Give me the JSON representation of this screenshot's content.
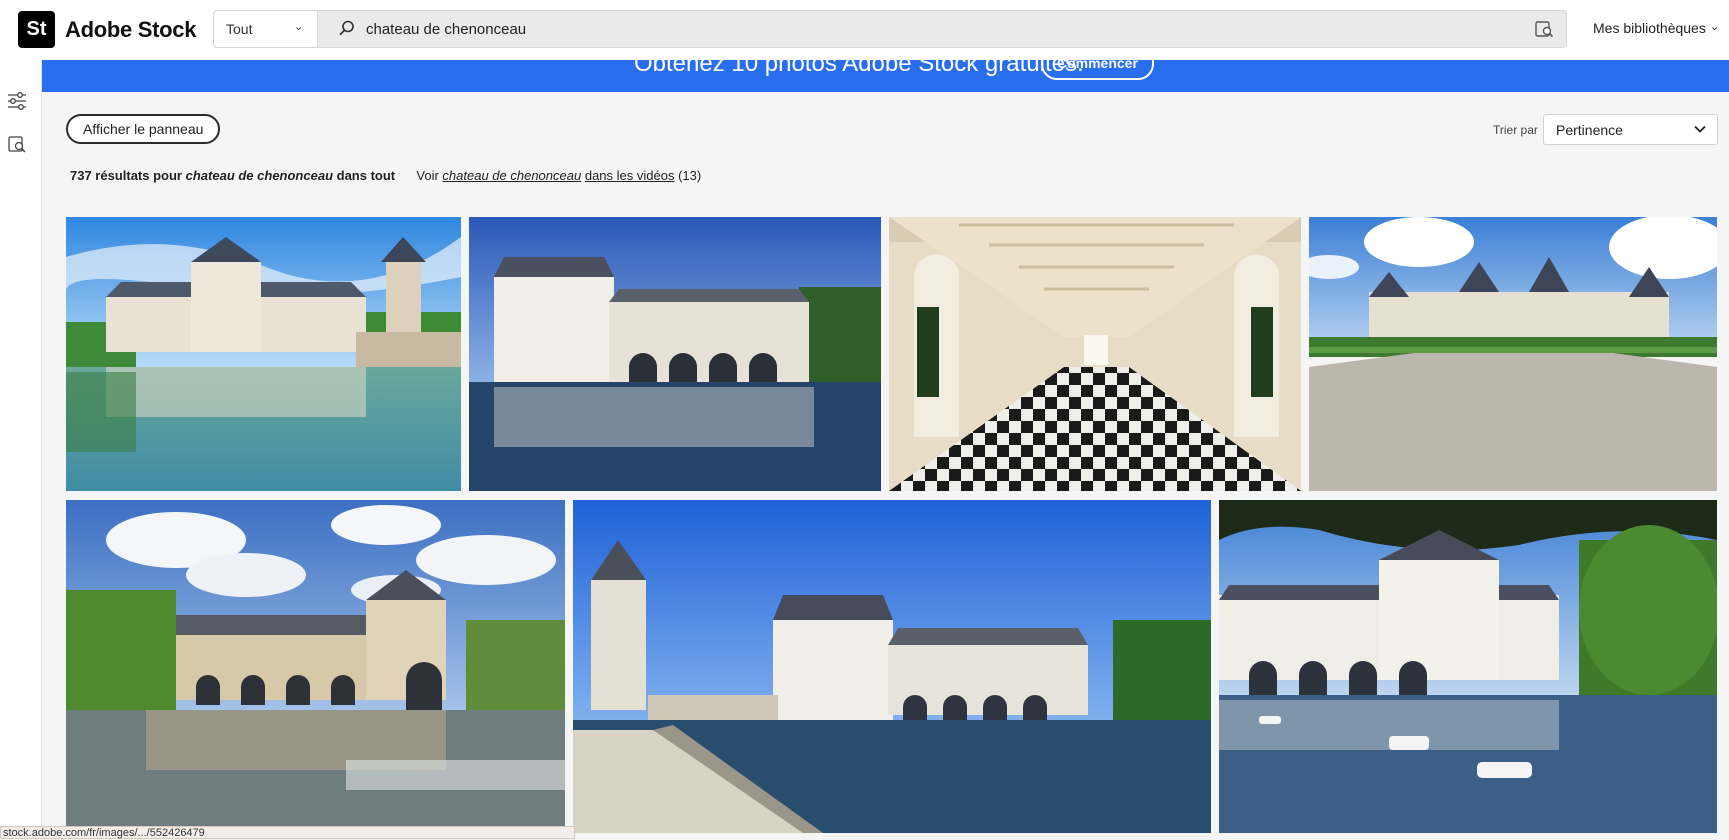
{
  "header": {
    "logo_mark": "St",
    "logo_text": "Adobe Stock",
    "scope_label": "Tout",
    "search_value": "chateau de chenonceau",
    "libraries_label": "Mes bibliothèques"
  },
  "banner": {
    "text": "Obtenez 10 photos Adobe Stock gratuites.",
    "button_label": "Commencer"
  },
  "toolbar": {
    "panel_button": "Afficher le panneau",
    "sort_label": "Trier par",
    "sort_value": "Pertinence"
  },
  "results": {
    "count_text": "737 résultats pour",
    "query": "chateau de chenonceau",
    "scope_text": "dans tout",
    "see_prefix": "Voir",
    "see_query": "chateau de chenonceau",
    "see_suffix": "dans les vidéos",
    "video_count": "(13)"
  },
  "images": [
    {
      "name": "chenonceau-reflection-photo"
    },
    {
      "name": "chenonceau-arches-photo"
    },
    {
      "name": "gallery-checkered-floor-photo"
    },
    {
      "name": "chambord-gardens-photo"
    },
    {
      "name": "chenonceau-cloudy-sky-photo"
    },
    {
      "name": "chenonceau-tower-bridge-photo"
    },
    {
      "name": "chenonceau-boats-photo"
    }
  ],
  "status_bar": {
    "url": "stock.adobe.com/fr/images/.../552426479"
  },
  "icons": [
    "search-icon",
    "chevron-down-icon",
    "visual-search-icon",
    "filter-sliders-icon",
    "visual-search-rail-icon"
  ]
}
